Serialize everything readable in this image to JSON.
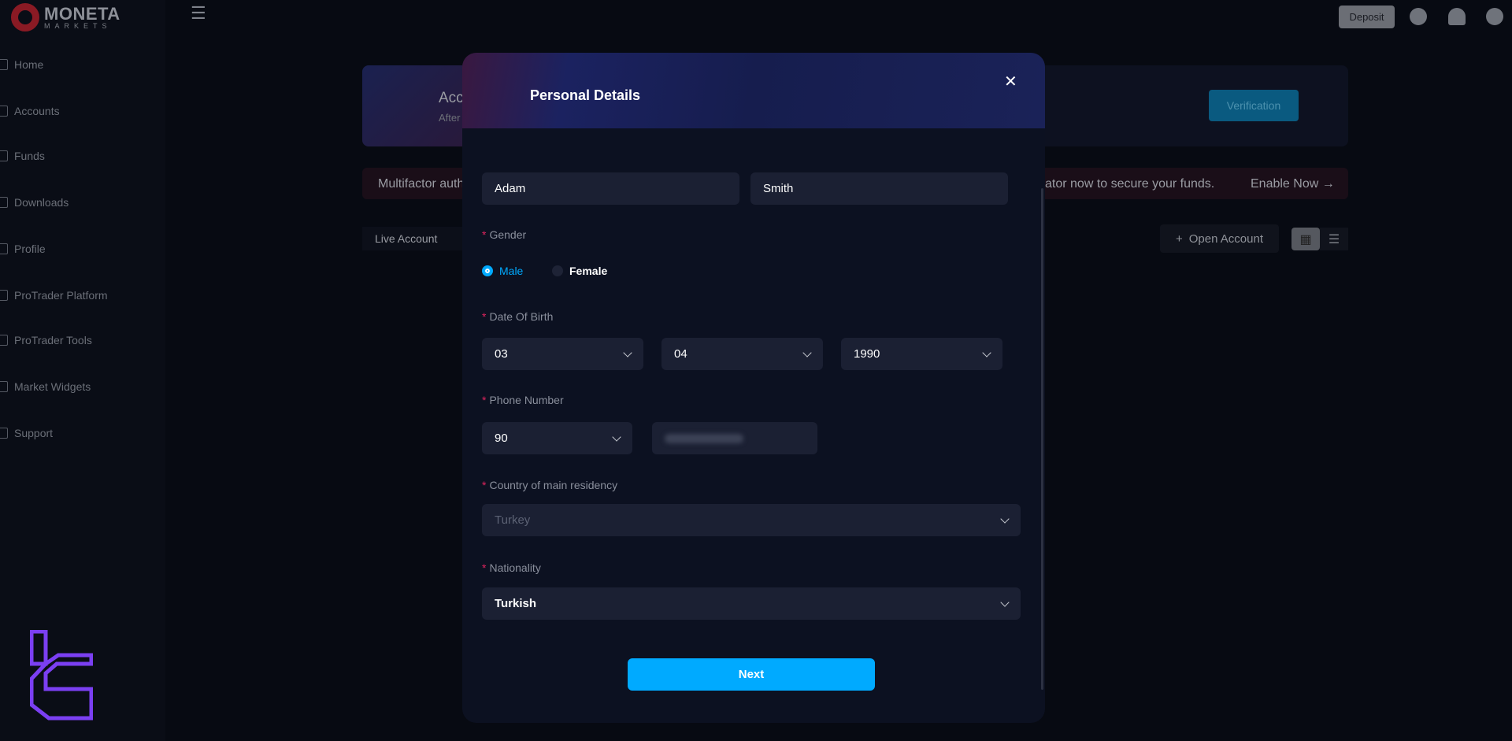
{
  "brand": {
    "name": "MONETA",
    "sub": "MARKETS"
  },
  "sidebar": {
    "items": [
      {
        "label": "Home"
      },
      {
        "label": "Accounts"
      },
      {
        "label": "Funds"
      },
      {
        "label": "Downloads"
      },
      {
        "label": "Profile"
      },
      {
        "label": "ProTrader Platform"
      },
      {
        "label": "ProTrader Tools"
      },
      {
        "label": "Market Widgets"
      },
      {
        "label": "Support"
      }
    ]
  },
  "topbar": {
    "deposit": "Deposit",
    "icons": [
      "globe-icon",
      "bell-icon",
      "avatar-icon"
    ]
  },
  "background": {
    "banner_title": "Acc",
    "banner_sub": "After",
    "verification": "Verification",
    "mfa_left": "Multifactor auth",
    "mfa_right": "ator now to secure your funds.",
    "enable_now": "Enable Now →",
    "live_account": "Live Account",
    "open_account": "Open Account"
  },
  "modal": {
    "title": "Personal Details",
    "first_name": "Adam",
    "last_name": "Smith",
    "gender": {
      "label": "Gender",
      "options": [
        "Male",
        "Female"
      ],
      "selected": "Male"
    },
    "dob": {
      "label": "Date Of Birth",
      "day": "03",
      "month": "04",
      "year": "1990"
    },
    "phone": {
      "label": "Phone Number",
      "code": "90"
    },
    "country": {
      "label": "Country of main residency",
      "value": "Turkey"
    },
    "nationality": {
      "label": "Nationality",
      "value": "Turkish"
    },
    "next": "Next"
  },
  "colors": {
    "accent": "#00aaff",
    "required": "#e0245e",
    "watermark": "#7b3ff2"
  }
}
